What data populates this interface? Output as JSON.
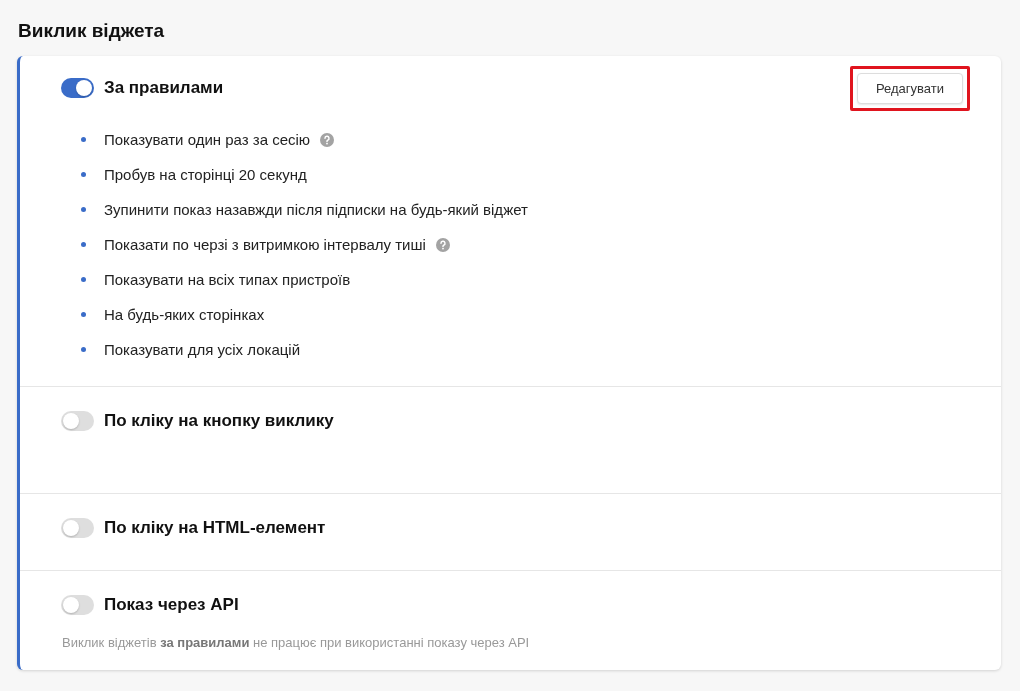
{
  "title": "Виклик віджета",
  "sections": [
    {
      "label": "За правилами",
      "on": true,
      "button": {
        "label": "Редагувати",
        "highlighted": true
      },
      "rules": [
        {
          "text": "Показувати один раз за сесію",
          "help": true
        },
        {
          "text": "Пробув на сторінці 20 секунд",
          "help": false
        },
        {
          "text": "Зупинити показ назавжди після підписки на будь-який віджет",
          "help": false
        },
        {
          "text": "Показати по черзі з витримкою інтервалу тиші",
          "help": true
        },
        {
          "text": "Показувати на всіх типах пристроїв",
          "help": false
        },
        {
          "text": "На будь-яких сторінках",
          "help": false
        },
        {
          "text": "Показувати для усіх локацій",
          "help": false
        }
      ]
    },
    {
      "label": "По кліку на кнопку виклику",
      "on": false
    },
    {
      "label": "По кліку на HTML-елемент",
      "on": false
    },
    {
      "label": "Показ через API",
      "on": false,
      "note": "Виклик віджетів **за правилами** не працює при використанні показу через API"
    }
  ]
}
